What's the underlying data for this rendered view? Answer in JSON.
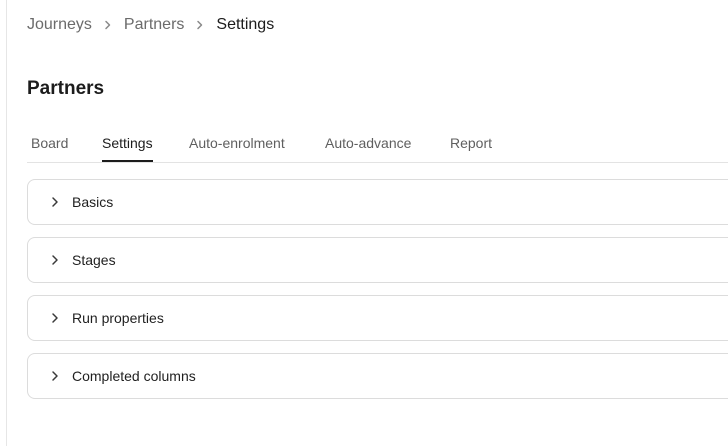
{
  "breadcrumb": {
    "items": [
      "Journeys",
      "Partners",
      "Settings"
    ]
  },
  "page": {
    "title": "Partners"
  },
  "tabs": [
    {
      "label": "Board",
      "active": false
    },
    {
      "label": "Settings",
      "active": true
    },
    {
      "label": "Auto-enrolment",
      "active": false
    },
    {
      "label": "Auto-advance",
      "active": false
    },
    {
      "label": "Report",
      "active": false
    }
  ],
  "sections": [
    {
      "label": "Basics",
      "expanded": false
    },
    {
      "label": "Stages",
      "expanded": false
    },
    {
      "label": "Run properties",
      "expanded": false
    },
    {
      "label": "Completed columns",
      "expanded": false
    }
  ],
  "icons": {
    "breadcrumb_separator": "chevron-right-icon",
    "section_toggle": "chevron-right-icon"
  },
  "colors": {
    "text_primary": "#1c1c1c",
    "text_muted": "#6b6b6b",
    "border": "#dcdcdc",
    "active_tab_underline": "#1c1c1c"
  }
}
